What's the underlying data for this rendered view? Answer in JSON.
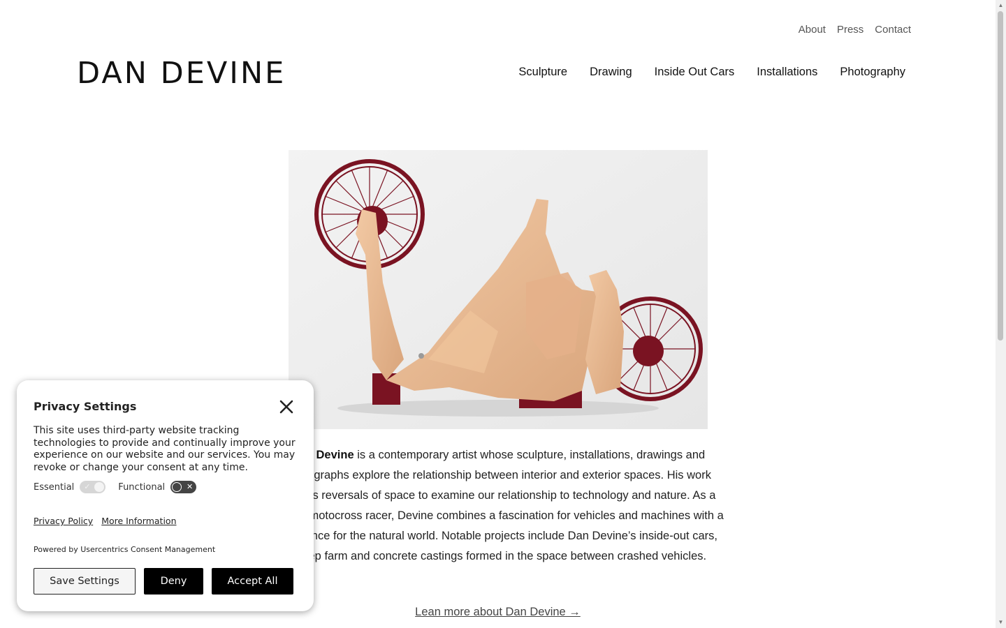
{
  "header": {
    "logo": "DAN DEVINE",
    "util_nav": [
      "About",
      "Press",
      "Contact"
    ],
    "main_nav": [
      "Sculpture",
      "Drawing",
      "Inside Out Cars",
      "Installations",
      "Photography"
    ]
  },
  "main": {
    "hero_alt": "Leather motorcycle sculpture",
    "bio_name": "Dan Devine",
    "bio_text": " is a contemporary artist whose sculpture, installations, drawings and photographs explore the relationship between interior and exterior spaces. His work creates reversals of space to examine our relationship to technology and nature. As a former motocross racer, Devine combines a fascination for vehicles and machines with a reverence for the natural world. Notable projects include Dan Devine’s inside-out cars, sheep farm and concrete castings formed in the space between crashed vehicles.",
    "learn_more": "Lean more about Dan Devine →"
  },
  "privacy": {
    "title": "Privacy Settings",
    "description": "This site uses third-party website tracking technologies to provide and continually improve your experience on our website and our services. You may revoke or change your consent at any time.",
    "toggles": [
      {
        "label": "Essential",
        "state": "on-disabled"
      },
      {
        "label": "Functional",
        "state": "off"
      }
    ],
    "links": [
      "Privacy Policy",
      "More Information"
    ],
    "powered_by": "Powered by Usercentrics Consent Management",
    "buttons": {
      "save": "Save Settings",
      "deny": "Deny",
      "accept": "Accept All"
    }
  },
  "colors": {
    "accent_button": "#000000",
    "sculpture_leather": "#e9b88f",
    "wheel_red": "#7a1322"
  }
}
